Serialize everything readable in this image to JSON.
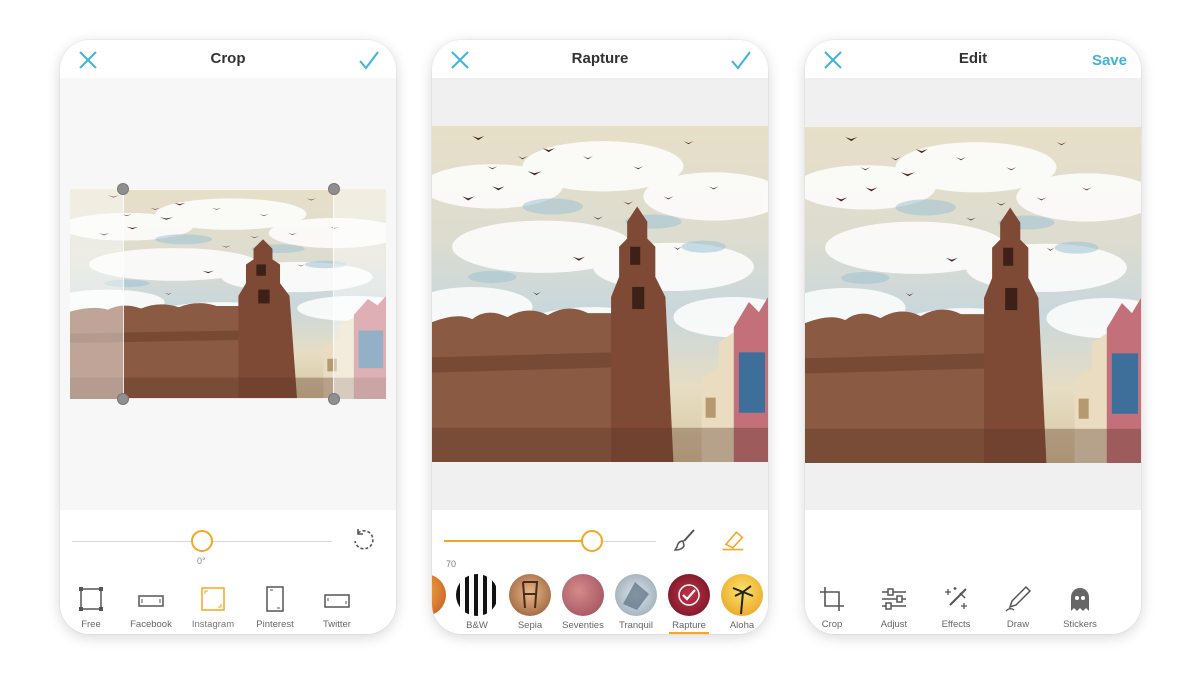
{
  "colors": {
    "accent": "#f5a623",
    "blue": "#3fb3d8",
    "text": "#333333"
  },
  "crop": {
    "title": "Crop",
    "close_icon": "close-icon",
    "confirm_icon": "check-icon",
    "angle": "0°",
    "angle_value": 0,
    "tools": [
      {
        "label": "Free",
        "icon": "free-crop-icon"
      },
      {
        "label": "Facebook",
        "icon": "facebook-ratio-icon"
      },
      {
        "label": "Instagram",
        "icon": "instagram-ratio-icon",
        "active": true
      },
      {
        "label": "Pinterest",
        "icon": "pinterest-ratio-icon"
      },
      {
        "label": "Twitter",
        "icon": "twitter-ratio-icon"
      }
    ]
  },
  "filter": {
    "title": "Rapture",
    "close_icon": "close-icon",
    "confirm_icon": "check-icon",
    "intensity": "70",
    "intensity_value": 0.7,
    "filters": [
      {
        "label": "B&W"
      },
      {
        "label": "Sepia"
      },
      {
        "label": "Seventies"
      },
      {
        "label": "Tranquil"
      },
      {
        "label": "Rapture",
        "active": true
      },
      {
        "label": "Aloha"
      }
    ]
  },
  "edit": {
    "title": "Edit",
    "close_icon": "close-icon",
    "save_label": "Save",
    "tools": [
      {
        "label": "Crop",
        "icon": "crop-icon"
      },
      {
        "label": "Adjust",
        "icon": "adjust-sliders-icon"
      },
      {
        "label": "Effects",
        "icon": "magic-wand-icon"
      },
      {
        "label": "Draw",
        "icon": "pencil-icon"
      },
      {
        "label": "Stickers",
        "icon": "ghost-icon"
      }
    ]
  }
}
